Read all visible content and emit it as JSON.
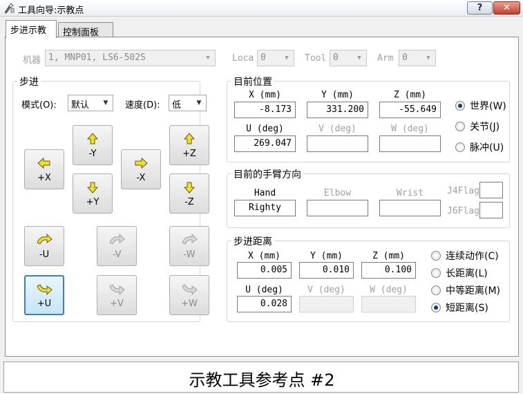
{
  "window": {
    "title": "工具向导:示教点",
    "help_label": "?",
    "close_label": "✕"
  },
  "tabs": [
    {
      "label": "步进示教",
      "active": true
    },
    {
      "label": "控制面板",
      "active": false
    }
  ],
  "top": {
    "robot_label": "机器",
    "robot_value": "1, MNP01, LS6-502S",
    "local_label": "Loca",
    "local_value": "0",
    "tool_label": "Tool",
    "tool_value": "0",
    "arm_label": "Arm",
    "arm_value": "0"
  },
  "jog": {
    "title": "步进",
    "mode_label": "模式(O):",
    "mode_value": "默认",
    "speed_label": "速度(D):",
    "speed_value": "低",
    "buttons": {
      "minus_x": "+X",
      "minus_y_top": "-Y",
      "plus_y": "+Y",
      "x_minus": "-X",
      "z_plus": "+Z",
      "z_minus": "-Z",
      "u_minus": "-U",
      "v_minus": "-V",
      "w_minus": "-W",
      "u_plus": "+U",
      "v_plus": "+V",
      "w_plus": "+W"
    }
  },
  "position": {
    "title": "目前位置",
    "x_label": "X (mm)",
    "y_label": "Y (mm)",
    "z_label": "Z (mm)",
    "u_label": "U (deg)",
    "v_label": "V (deg)",
    "w_label": "W (deg)",
    "x_value": "-8.173",
    "y_value": "331.200",
    "z_value": "-55.649",
    "u_value": "269.047",
    "v_value": "",
    "w_value": "",
    "modes": [
      {
        "label": "世界(W)",
        "selected": true
      },
      {
        "label": "关节(J)",
        "selected": false
      },
      {
        "label": "脉冲(U)",
        "selected": false
      }
    ]
  },
  "orientation": {
    "title": "目前的手臂方向",
    "hand_label": "Hand",
    "elbow_label": "Elbow",
    "wrist_label": "Wrist",
    "hand_value": "Righty",
    "elbow_value": "",
    "wrist_value": "",
    "j4flag_label": "J4Flag",
    "j6flag_label": "J6Flag"
  },
  "distance": {
    "title": "步进距离",
    "x_label": "X (mm)",
    "y_label": "Y (mm)",
    "z_label": "Z (mm)",
    "u_label": "U (deg)",
    "v_label": "V (deg)",
    "w_label": "W (deg)",
    "x_value": "0.005",
    "y_value": "0.010",
    "z_value": "0.100",
    "u_value": "0.028",
    "options": [
      {
        "label": "连续动作(C)",
        "selected": false
      },
      {
        "label": "长距离(L)",
        "selected": false
      },
      {
        "label": "中等距离(M)",
        "selected": false
      },
      {
        "label": "短距离(S)",
        "selected": true
      }
    ]
  },
  "bottom": {
    "caption": "示教工具参考点 #2"
  },
  "colors": {
    "arrow_yellow": "#f5e600",
    "selected_border": "#3c7fb1",
    "close_red": "#c6402b"
  }
}
